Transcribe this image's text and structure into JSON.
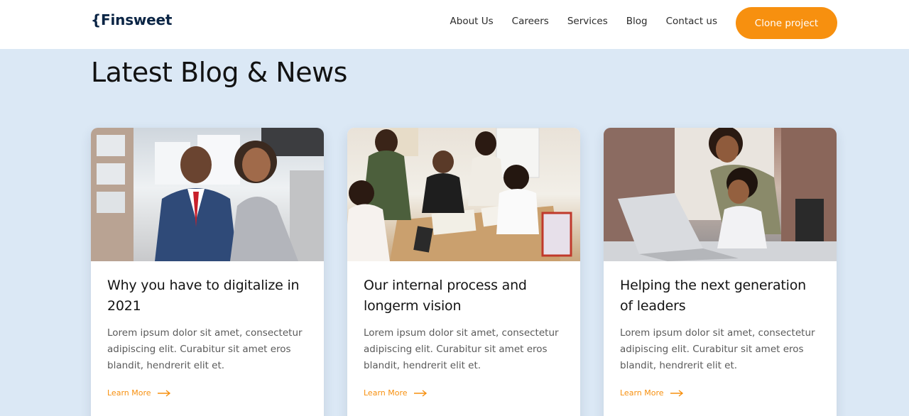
{
  "header": {
    "logo": "{Finsweet",
    "nav": [
      "About Us",
      "Careers",
      "Services",
      "Blog",
      "Contact us"
    ],
    "cta": "Clone project"
  },
  "section": {
    "title": "Latest Blog & News"
  },
  "cards": [
    {
      "title": "Why you have to digitalize in 2021",
      "text": "Lorem ipsum dolor sit amet, consectetur adipiscing elit. Curabitur sit amet eros blandit, hendrerit elit et.",
      "link": "Learn More"
    },
    {
      "title": "Our internal process and longerm vision",
      "text": "Lorem ipsum dolor sit amet, consectetur adipiscing elit. Curabitur sit amet eros blandit, hendrerit elit et.",
      "link": "Learn More"
    },
    {
      "title": "Helping the next generation of leaders",
      "text": "Lorem ipsum dolor sit amet, consectetur adipiscing elit. Curabitur sit amet eros blandit, hendrerit elit et.",
      "link": "Learn More"
    }
  ],
  "colors": {
    "accent": "#f7900f",
    "brand": "#0b2545",
    "background": "#dbe8f5"
  },
  "icons": {
    "link_arrow": "arrow-right-icon"
  }
}
